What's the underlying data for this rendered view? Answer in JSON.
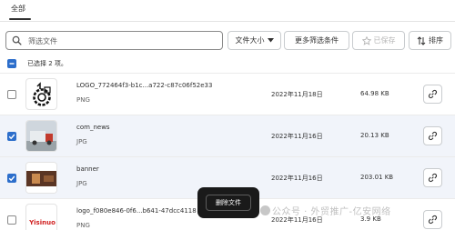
{
  "tabs": {
    "all": "全部"
  },
  "search": {
    "placeholder": "筛选文件"
  },
  "toolbar": {
    "sort_label": "文件大小",
    "more_filters_label": "更多筛选条件",
    "saved_label": "已保存",
    "order_label": "排序"
  },
  "selection": {
    "text": "已选择 2 项。"
  },
  "files": [
    {
      "name": "LOGO_772464f3-b1c...a722-c87c06f52e33",
      "type": "PNG",
      "date": "2022年11月18日",
      "size": "64.98 KB",
      "selected": false
    },
    {
      "name": "com_news",
      "type": "JPG",
      "date": "2022年11月16日",
      "size": "20.13 KB",
      "selected": true
    },
    {
      "name": "banner",
      "type": "JPG",
      "date": "2022年11月16日",
      "size": "203.01 KB",
      "selected": true
    },
    {
      "name": "logo_f080e846-0f6...b641-47dcc4118",
      "type": "PNG",
      "date": "2022年11月16日",
      "size": "3.9 KB",
      "selected": false
    }
  ],
  "thumb_brand": "Yisinuo",
  "toast": {
    "delete_label": "删除文件"
  },
  "watermark": "公众号 · 外贸推广-亿安网络",
  "colors": {
    "accent": "#2c6ecb",
    "text": "#303030",
    "subdued": "#616161"
  }
}
